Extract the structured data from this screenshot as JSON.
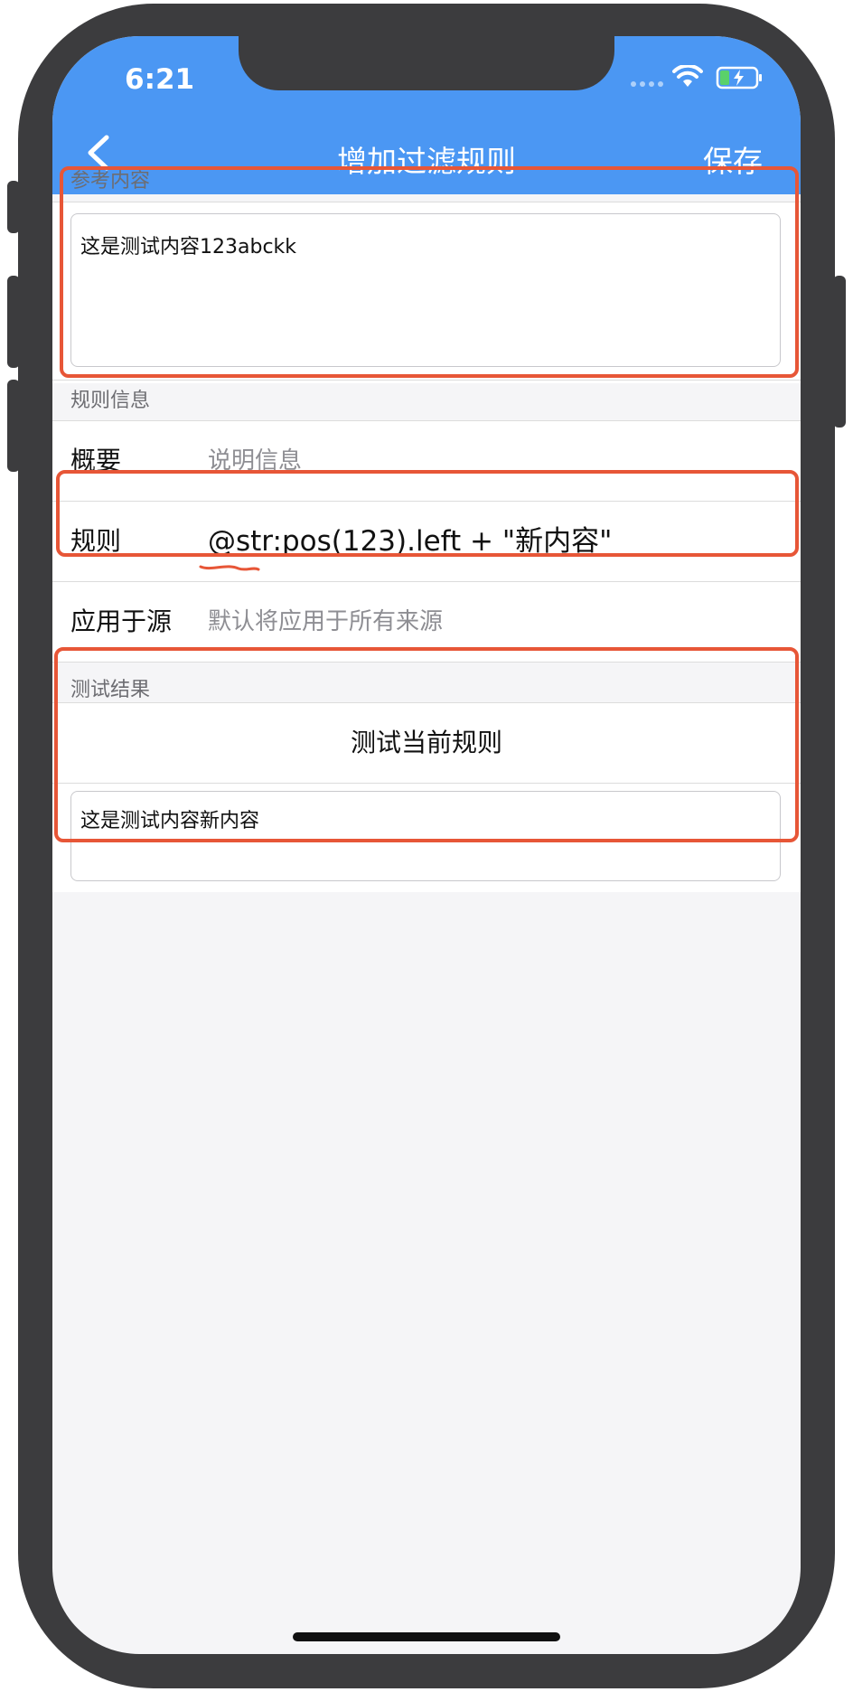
{
  "status_bar": {
    "time": "6:21"
  },
  "nav": {
    "title": "增加过滤规则",
    "save_label": "保存"
  },
  "reference": {
    "header": "参考内容",
    "content": "这是测试内容123abckk"
  },
  "rule_info": {
    "header": "规则信息",
    "summary_label": "概要",
    "summary_placeholder": "说明信息",
    "rule_label": "规则",
    "rule_value": "@str:pos(123).left + \"新内容\"",
    "source_label": "应用于源",
    "source_placeholder": "默认将应用于所有来源"
  },
  "test": {
    "header": "测试结果",
    "button_label": "测试当前规则",
    "result": "这是测试内容新内容"
  },
  "colors": {
    "accent": "#4b97f3",
    "highlight": "#e75637",
    "frame": "#3c3c3e"
  }
}
